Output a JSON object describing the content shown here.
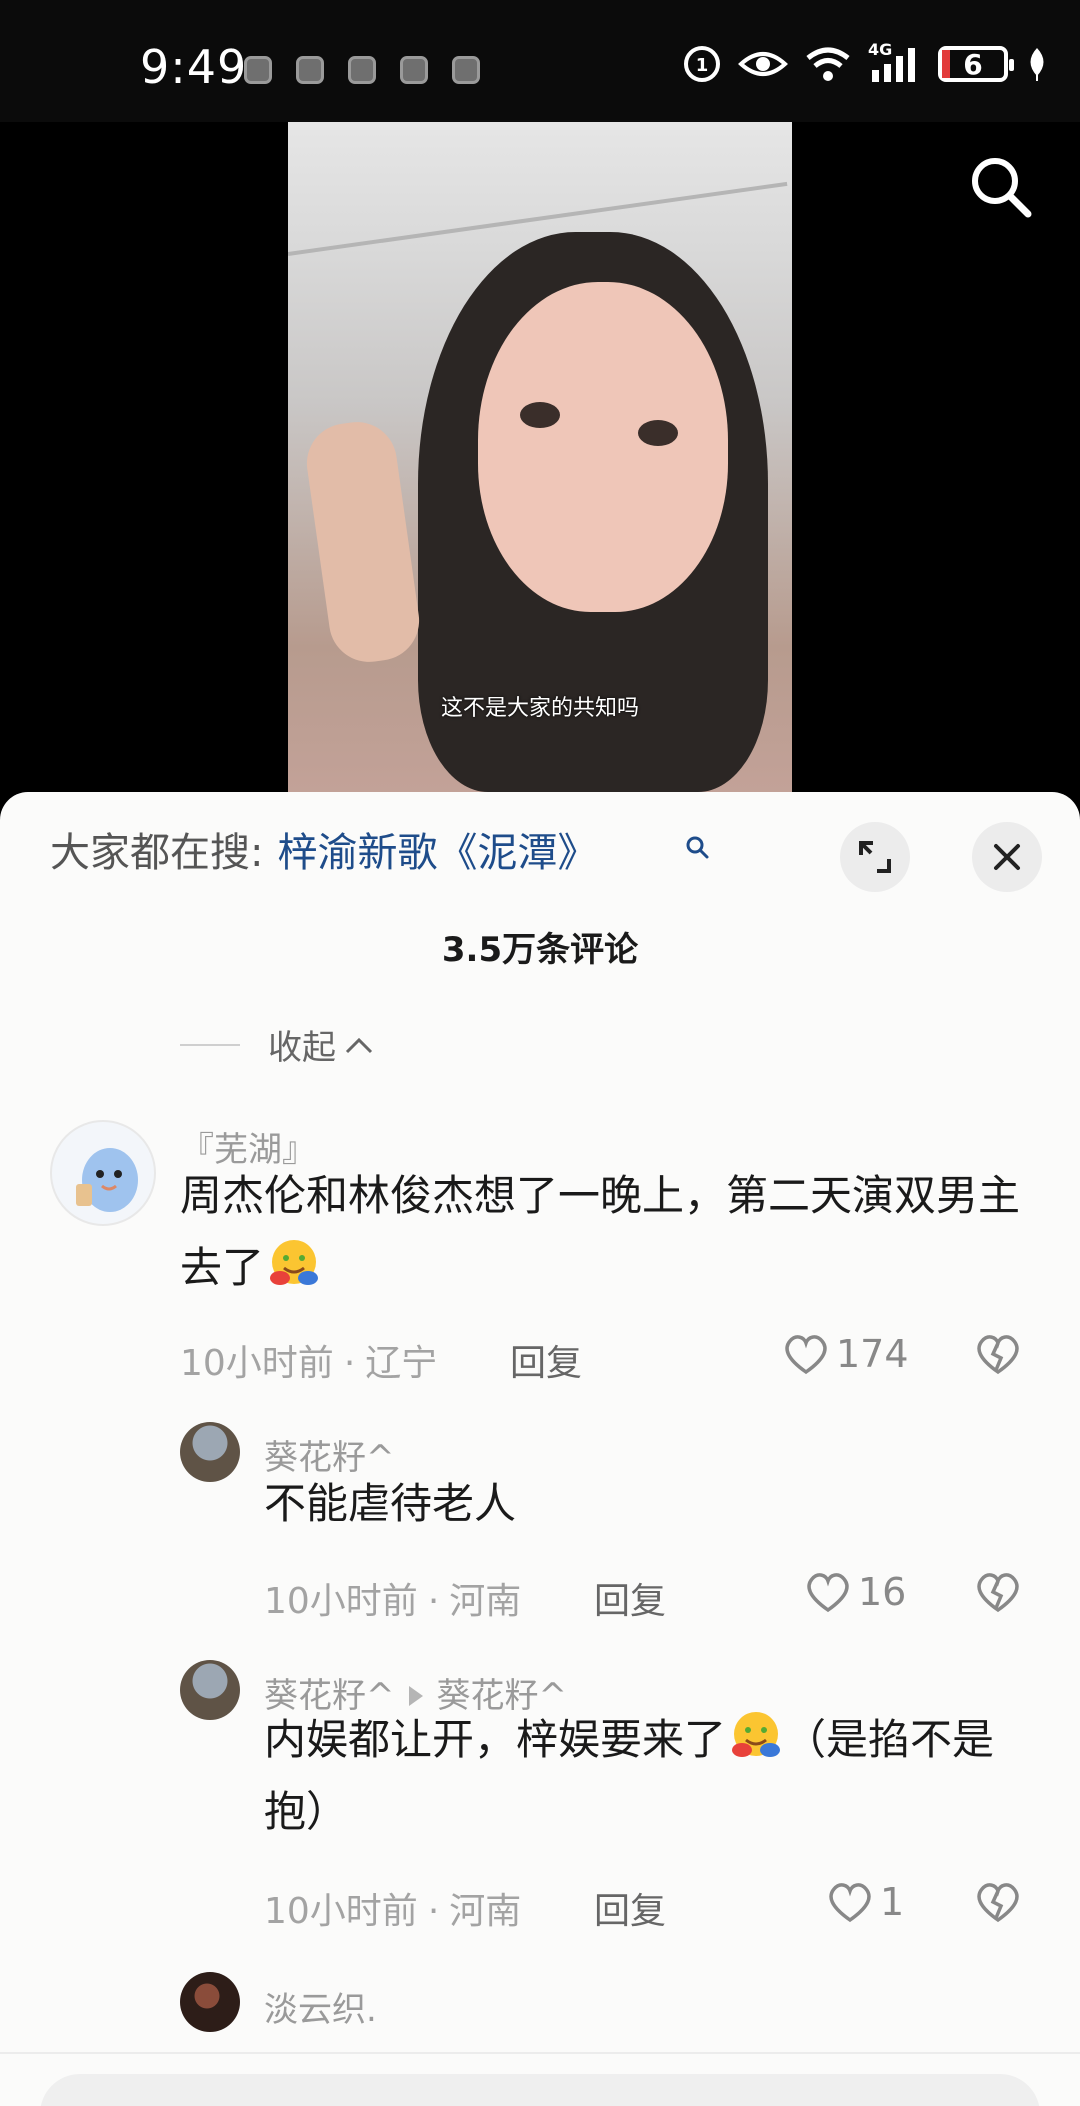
{
  "status_bar": {
    "time": "9:49",
    "battery": "6",
    "network": "4G",
    "icons": [
      "hd-icon",
      "eye-icon",
      "wifi-icon",
      "signal-icon",
      "battery-icon",
      "leaf-icon"
    ]
  },
  "video": {
    "subtitle": "这不是大家的共知吗",
    "search_icon": "search-icon"
  },
  "comments_sheet": {
    "trend_label": "大家都在搜:",
    "trend_keyword": "梓渝新歌《泥潭》",
    "expand_icon": "expand-icon",
    "close_icon": "close-icon",
    "count_title": "3.5万条评论",
    "collapse_label": "收起",
    "comments": [
      {
        "username": "『芜湖』",
        "text": "周杰伦和林俊杰想了一晚上，第二天演双男主去了",
        "time": "10小时前",
        "location": "辽宁",
        "reply_label": "回复",
        "likes": "174"
      },
      {
        "username": "葵花籽^",
        "text": "不能虐待老人",
        "time": "10小时前",
        "location": "河南",
        "reply_label": "回复",
        "likes": "16"
      },
      {
        "username": "葵花籽^",
        "reply_to": "葵花籽^",
        "text": "内娱都让开，梓娱要来了",
        "text_after": "（是掐不是抱）",
        "time": "10小时前",
        "location": "河南",
        "reply_label": "回复",
        "likes": "1"
      },
      {
        "username": "淡云织."
      }
    ]
  }
}
